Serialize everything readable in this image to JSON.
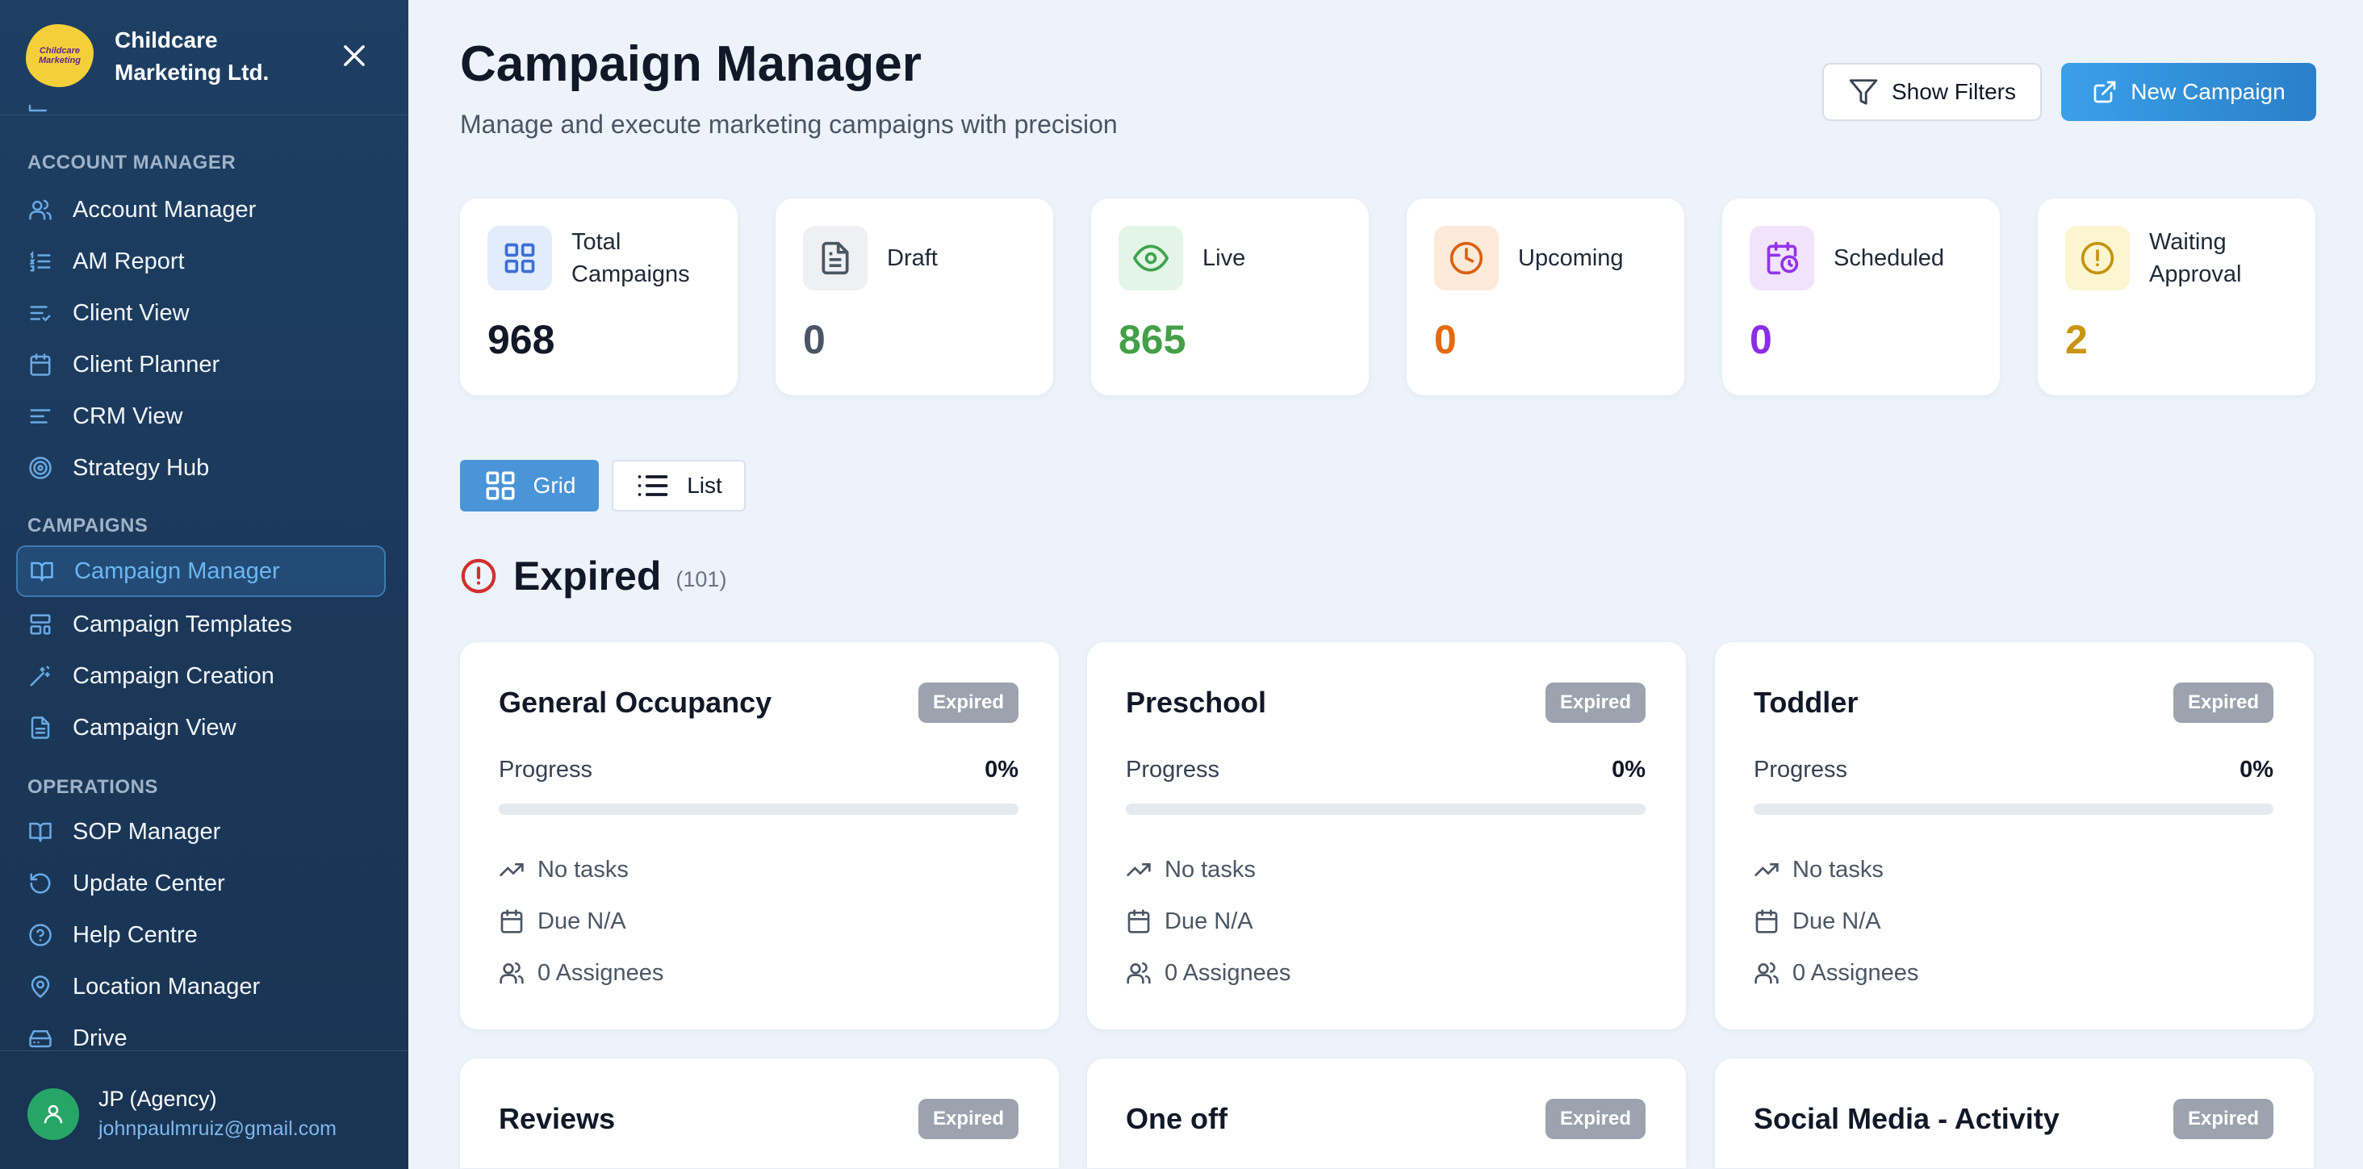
{
  "sidebar": {
    "org_name": "Childcare Marketing Ltd.",
    "logo_text": "Childcare Marketing",
    "sections": [
      {
        "label": "ACCOUNT MANAGER"
      },
      {
        "label": "CAMPAIGNS"
      },
      {
        "label": "OPERATIONS"
      }
    ],
    "items": [
      {
        "label": "Account Manager",
        "icon": "users-icon"
      },
      {
        "label": "AM Report",
        "icon": "list-ordered-icon"
      },
      {
        "label": "Client View",
        "icon": "list-check-icon"
      },
      {
        "label": "Client Planner",
        "icon": "calendar-icon"
      },
      {
        "label": "CRM View",
        "icon": "align-left-icon"
      },
      {
        "label": "Strategy Hub",
        "icon": "target-icon"
      },
      {
        "label": "Campaign Manager",
        "icon": "book-open-icon",
        "active": true
      },
      {
        "label": "Campaign Templates",
        "icon": "layout-template-icon"
      },
      {
        "label": "Campaign Creation",
        "icon": "wand-icon"
      },
      {
        "label": "Campaign View",
        "icon": "file-text-icon"
      },
      {
        "label": "SOP Manager",
        "icon": "book-icon"
      },
      {
        "label": "Update Center",
        "icon": "rotate-ccw-icon"
      },
      {
        "label": "Help Centre",
        "icon": "help-circle-icon"
      },
      {
        "label": "Location Manager",
        "icon": "map-pin-icon"
      },
      {
        "label": "Drive",
        "icon": "hard-drive-icon"
      }
    ],
    "user": {
      "name": "JP (Agency)",
      "email": "johnpaulmruiz@gmail.com"
    }
  },
  "header": {
    "title": "Campaign Manager",
    "subtitle": "Manage and execute marketing campaigns with precision",
    "show_filters_label": "Show Filters",
    "new_campaign_label": "New Campaign"
  },
  "stats": [
    {
      "label": "Total Campaigns",
      "value": "968",
      "color": "#111827",
      "icon": "grid-icon",
      "icon_bg": "#e3ecfb",
      "icon_color": "#3b6fd4"
    },
    {
      "label": "Draft",
      "value": "0",
      "color": "#4b5563",
      "icon": "file-text-icon",
      "icon_bg": "#eef0f3",
      "icon_color": "#4b5563"
    },
    {
      "label": "Live",
      "value": "865",
      "color": "#43a047",
      "icon": "eye-icon",
      "icon_bg": "#e3f5e6",
      "icon_color": "#3fa34d"
    },
    {
      "label": "Upcoming",
      "value": "0",
      "color": "#e46a12",
      "icon": "clock-icon",
      "icon_bg": "#fde9d8",
      "icon_color": "#d9610f"
    },
    {
      "label": "Scheduled",
      "value": "0",
      "color": "#8b2ee6",
      "icon": "calendar-clock-icon",
      "icon_bg": "#f1e3fb",
      "icon_color": "#9333ea"
    },
    {
      "label": "Waiting Approval",
      "value": "2",
      "color": "#c99512",
      "icon": "alert-circle-icon",
      "icon_bg": "#fdf5cf",
      "icon_color": "#c4930e"
    }
  ],
  "view": {
    "grid_label": "Grid",
    "list_label": "List",
    "active": "grid"
  },
  "section": {
    "title": "Expired",
    "count": "(101)",
    "color": "#d32f2f"
  },
  "campaigns": [
    {
      "title": "General Occupancy",
      "status": "Expired",
      "progress_label": "Progress",
      "progress_value": "0%",
      "progress_fraction": 0,
      "tasks": "No tasks",
      "due": "Due N/A",
      "assignees": "0 Assignees"
    },
    {
      "title": "Preschool",
      "status": "Expired",
      "progress_label": "Progress",
      "progress_value": "0%",
      "progress_fraction": 0,
      "tasks": "No tasks",
      "due": "Due N/A",
      "assignees": "0 Assignees"
    },
    {
      "title": "Toddler",
      "status": "Expired",
      "progress_label": "Progress",
      "progress_value": "0%",
      "progress_fraction": 0,
      "tasks": "No tasks",
      "due": "Due N/A",
      "assignees": "0 Assignees"
    },
    {
      "title": "Reviews",
      "status": "Expired"
    },
    {
      "title": "One off",
      "status": "Expired"
    },
    {
      "title": "Social Media - Activity",
      "status": "Expired"
    }
  ]
}
